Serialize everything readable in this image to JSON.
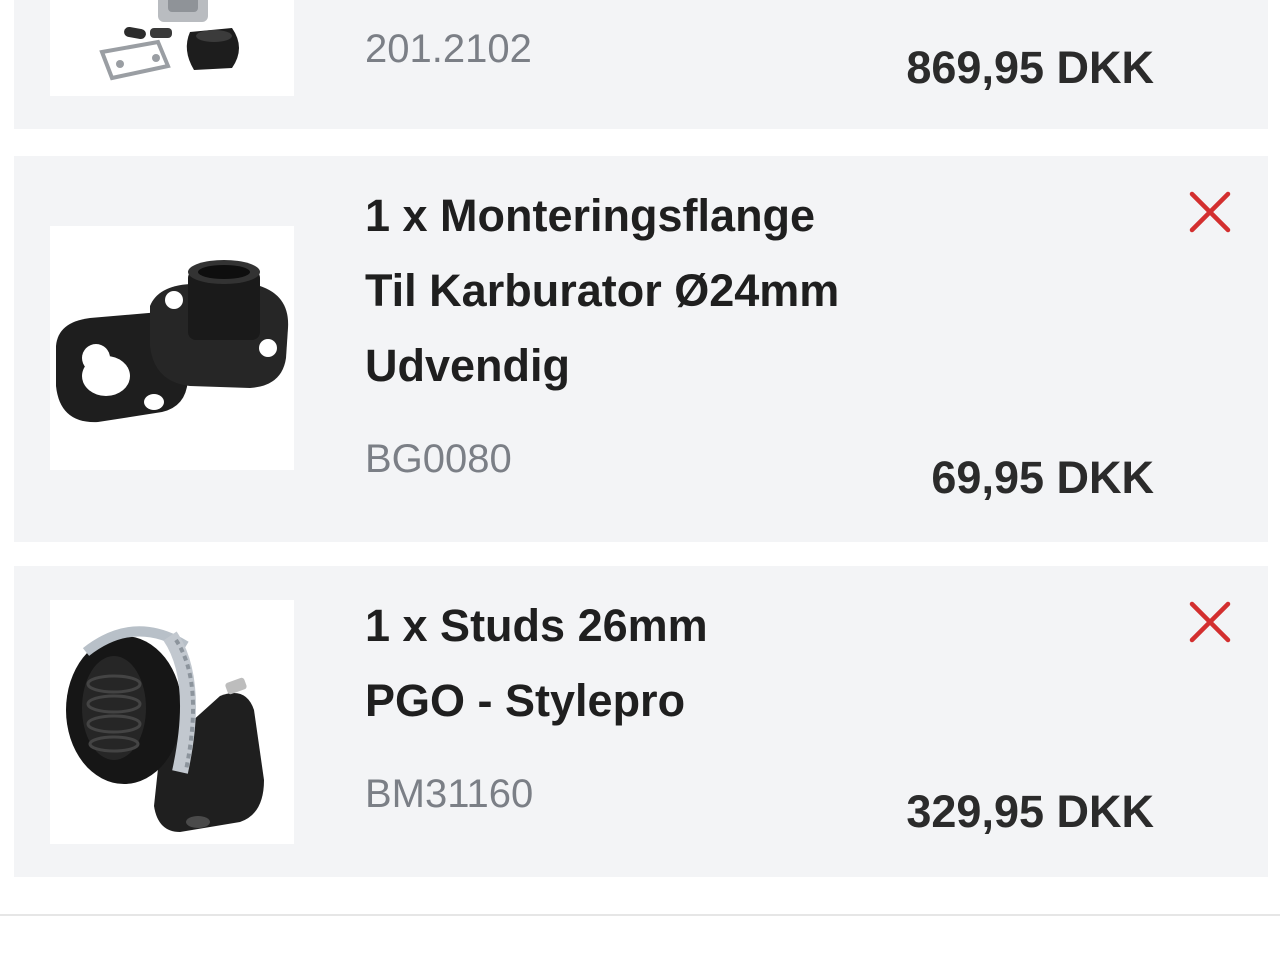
{
  "cart": {
    "items": [
      {
        "sku": "201.2102",
        "price": "869,95 DKK",
        "image_icon": "carburetor-kit-icon"
      },
      {
        "title_lines": [
          "1 x Monteringsflange",
          "Til Karburator Ø24mm",
          "Udvendig"
        ],
        "sku": "BG0080",
        "price": "69,95 DKK",
        "image_icon": "mounting-flange-icon",
        "remove_icon": "close-icon"
      },
      {
        "title_lines": [
          "1 x Studs 26mm",
          "PGO - Stylepro"
        ],
        "sku": "BM31160",
        "price": "329,95 DKK",
        "image_icon": "intake-manifold-icon",
        "remove_icon": "close-icon"
      }
    ]
  },
  "colors": {
    "card_background": "#f3f4f6",
    "remove_icon": "#d32f2f",
    "sku_text": "#7b7f86",
    "price_text": "#2b2b2b"
  }
}
